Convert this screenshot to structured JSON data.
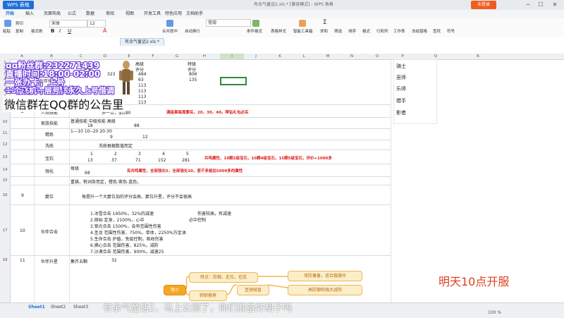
{
  "titlebar": {
    "app_tab": "WPS 表格",
    "doc_title": "有余气童话2.xls * [兼容模式] - WPS 表格",
    "login_label": "未登录",
    "controls": [
      "─",
      "☐",
      "✕"
    ]
  },
  "menu": [
    "开始",
    "插入",
    "页面布局",
    "公式",
    "数据",
    "审阅",
    "视图",
    "开发工具",
    "特色应用",
    "文档助手"
  ],
  "ribbon": {
    "font_name": "宋体",
    "font_size": "12",
    "number_format": "常规",
    "buttons": [
      "粘贴",
      "剪切",
      "复制",
      "格式刷",
      "合并居中",
      "自动换行",
      "条件格式",
      "表格样式",
      "智能工具箱",
      "求和",
      "筛选",
      "排序",
      "格式",
      "行和列",
      "工作表",
      "冻结窗格",
      "查找",
      "符号"
    ]
  },
  "file_tab": "有余气童话2.xls *",
  "columns": [
    "A",
    "B",
    "C",
    "D",
    "E",
    "F",
    "G",
    "H",
    "I",
    "J",
    "K",
    "L",
    "M",
    "N",
    "O",
    "P",
    "Q",
    "R"
  ],
  "rows": [
    "1",
    "2",
    "3",
    "4",
    "5",
    "6",
    "7",
    "8",
    "9",
    "10",
    "11",
    "12",
    "13",
    "14",
    "15",
    "16",
    "17",
    "18",
    "19",
    "20",
    "21",
    "22",
    "23",
    "24",
    "25",
    "26",
    "27",
    "28",
    "29",
    "30",
    "31",
    "32",
    "33",
    "34",
    "35",
    "36",
    "37",
    "38",
    "39",
    "40",
    "41",
    "42"
  ],
  "cells": {
    "mid": "中级",
    "high": "高级",
    "special": "特级",
    "score1": "评分",
    "score2": "评分",
    "score3": "评分",
    "v323": "323",
    "v484": "484",
    "v806": "806",
    "v63": "63",
    "v135": "135",
    "partner_skill": "伙伴技能",
    "v113a": "113",
    "v113b": "113",
    "v113c": "113",
    "v113d": "113",
    "person_skill": "人物技能",
    "person_skill_desc": "多一点，加180",
    "red_note1": "满级果每周要买，20，30，40。帮钻礼包必买",
    "clan_skill": "家族技能",
    "clan_levels": "普通技能  中级技能  高级",
    "clan_v18": "18",
    "clan_v88": "88",
    "refine": "精炼",
    "refine_ranges": "1---10    10--20    20-30",
    "refine_v9": "9",
    "refine_v12": "12",
    "wash": "洗练",
    "wash_desc": "洗练根据数值而定",
    "gem": "宝石",
    "gem_levels": [
      "1",
      "2",
      "3",
      "4",
      "5"
    ],
    "gem_values": [
      "13",
      "37",
      "71",
      "152",
      "281"
    ],
    "red_note2": "共鸣属性，10颗2级宝石，10颗4级宝石，15颗5级宝石，评价+1000多",
    "strengthen": "强化",
    "every_level": "每级",
    "strengthen_v68": "68",
    "red_note3": "有共鸣属性，全部强化5，全部强化10，差不多能加1000多的属性",
    "recast": "重铸，税词条而定，橙色-紫色-蓝色，",
    "rank": "爵位",
    "rank_desc": "每提升一个大爵位加的评分会高，爵位升星，评分不会很高",
    "partner_combo": "伙伴合击",
    "combo_list": [
      "1.冰雪合击        1950%，32%的减速",
      "2.原始              定身，2100%，心中",
      "3.锁光合击        1500%，会有范围性伤害",
      "4.圣龙        范围性伤害，750%，单体，2250%万金油",
      "5.生命合击        护盾，免疫控制，吸收伤害",
      "6.拂心合击        范围伤害，825%，减防",
      "7.沙漠合击        范围伤害，900%，减速25"
    ],
    "combo_note1": "伤害较高，有减速",
    "combo_note2": "必中控制",
    "partner_up": "伙伴升星",
    "five_stars": "集齐五颗",
    "v32": "32",
    "row_10": "10",
    "row_11": "11",
    "row_9": "9",
    "row_2": "2"
  },
  "overlays": {
    "qq_group": "qq粉丝群:232271439",
    "live_time": "直播时间:18:00-02:00",
    "card1": "一张办卡，上号",
    "card10": "10张办卡，战墨车驾",
    "feibo": "一个飞机一层号，永久上号借调",
    "notice": "微信群在QQ群的公告里",
    "open_time": "明天10点开服",
    "subtitle": "有余气童话2，马上公测了，你们准备好胡子吗"
  },
  "side_list": [
    "骑士",
    "巫师",
    "乐师",
    "猎手",
    "影者"
  ],
  "mindmap": {
    "root": "骑士",
    "n1": "特点：防御，走位，坦克",
    "n2": "转职推荐",
    "n3": "攻防兼备，适合做操作",
    "n4": "圣骑骑皇",
    "n5": "高防御和强大减伤"
  },
  "sheets": [
    "Sheet1",
    "Sheet2",
    "Sheet3"
  ],
  "zoom": "100 %"
}
